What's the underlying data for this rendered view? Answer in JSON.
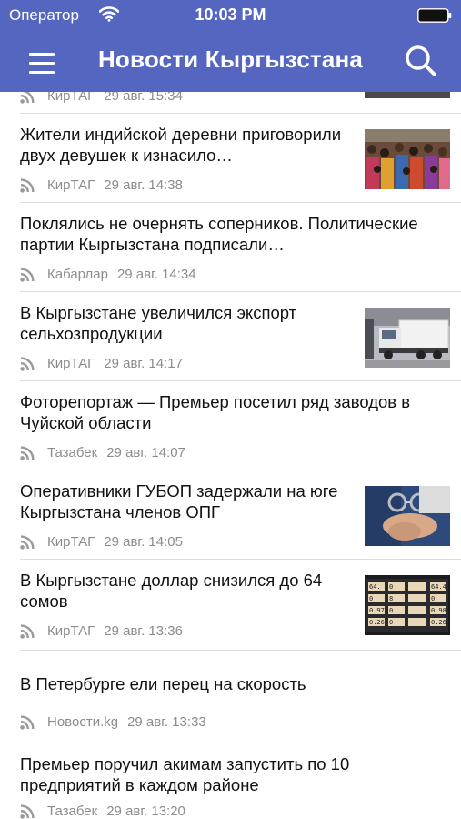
{
  "status": {
    "carrier": "Оператор",
    "time": "10:03 PM"
  },
  "nav": {
    "title": "Новости Кыргызстана"
  },
  "news": [
    {
      "title": "",
      "source": "КирТАГ",
      "date": "29 авг. 15:34",
      "thumb": "thumb-top"
    },
    {
      "title": "Жители индийской деревни приговорили двух девушек к изнасило…",
      "source": "КирТАГ",
      "date": "29 авг. 14:38",
      "thumb": "crowd-photo"
    },
    {
      "title": "Поклялись не очернять соперников. Политические партии Кыргызстана подписали…",
      "source": "Кабарлар",
      "date": "29 авг. 14:34",
      "thumb": ""
    },
    {
      "title": "В Кыргызстане увеличился экспорт сельхозпродукции",
      "source": "КирТАГ",
      "date": "29 авг. 14:17",
      "thumb": "truck-photo"
    },
    {
      "title": "Фоторепортаж — Премьер посетил ряд заводов в Чуйской области",
      "source": "Тазабек",
      "date": "29 авг. 14:07",
      "thumb": ""
    },
    {
      "title": "Оперативники ГУБОП задержали на юге Кыргызстана членов ОПГ",
      "source": "КирТАГ",
      "date": "29 авг. 14:05",
      "thumb": "handcuffs-photo"
    },
    {
      "title": "В Кыргызстане доллар снизился до 64 сомов",
      "source": "КирТАГ",
      "date": "29 авг. 13:36",
      "thumb": "exchange-board-photo"
    },
    {
      "title": "В Петербурге ели перец на скорость",
      "source": "Новости.kg",
      "date": "29 авг. 13:33",
      "thumb": ""
    },
    {
      "title": "Премьер поручил акимам запустить по 10 предприятий в каждом районе",
      "source": "Тазабек",
      "date": "29 авг. 13:20",
      "thumb": ""
    }
  ],
  "colors": {
    "header": "#5466c0",
    "meta_text": "#8c8c8c",
    "divider": "#dedede"
  },
  "icons": {
    "menu": "menu-icon",
    "search": "search-icon",
    "feed": "rss-icon",
    "wifi": "wifi-icon",
    "battery": "battery-icon"
  }
}
